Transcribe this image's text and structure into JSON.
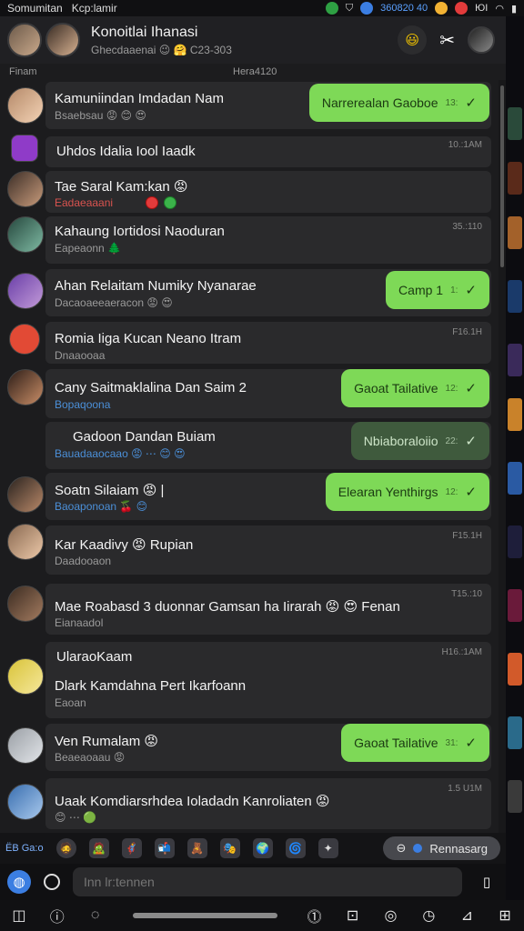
{
  "status_bar": {
    "left_1": "Somumitan",
    "left_2": "Kcp:lamir",
    "right_label": "360820 40",
    "right_2": "ЮΙ",
    "colors": [
      "#2ea043",
      "#3b7ee2",
      "#f2b233",
      "#e23b3b"
    ]
  },
  "header": {
    "title": "Konoitlai Ihanasi",
    "subtitle": "Ghecdaaenai 😉 🤗 C23-303",
    "actions": {
      "smile": "😃",
      "tools": "✂",
      "avatar": ""
    }
  },
  "subbar": {
    "left": "Finam",
    "center": "Hera4120"
  },
  "chats": [
    {
      "title": "Kamuniindan Imdadan Nam",
      "sub": "Bsaebsau 😡 😊 😍",
      "sub_color": "gray",
      "bubble": {
        "text": "Narrerealan Gaoboe",
        "time": "13:",
        "style": "bright"
      }
    },
    {
      "title": "Uhdos Idalia Iool Iaadk",
      "sub": "",
      "time": "10.:1AM",
      "sub_color": "gray"
    },
    {
      "title": "Tae Saral Kam:kan 😡",
      "sub": "Eadaeaaani",
      "sub_color": "red"
    },
    {
      "title": "Kahaung Iortidosi Naoduran",
      "sub": "Eapeaonn 🌲",
      "time": "35.:110",
      "sub_color": "gray"
    },
    {
      "title": "Ahan Relaitam Numiky Nyanarae",
      "sub": "Dacaoaeeaeracon 😡 😍",
      "sub_color": "gray",
      "bubble": {
        "text": "Camp 1",
        "time": "1:",
        "style": "bright"
      }
    },
    {
      "title": "Romia Iiga Kucan Neano Itram",
      "sub": "Dnaaooaa",
      "time": "F16.1H",
      "sub_color": "gray"
    },
    {
      "title": "Cany Saitmaklalina Dan Saim 2",
      "sub": "Bopaqoona",
      "sub_color": "blue",
      "bubble": {
        "text": "Gaoat Tailative",
        "time": "12:",
        "style": "bright"
      }
    },
    {
      "title": "Gadoon Dandan Buiam",
      "sub": "Bauadaaocaao 😡 ⋯ 😊 😍",
      "sub_color": "blue",
      "bubble": {
        "text": "Nbiaboraloiio",
        "time": "22:",
        "style": "dim"
      }
    },
    {
      "title": "Soatn Silaiam 😡 |",
      "sub": "Baoaponoan 🍒 😊",
      "sub_color": "blue",
      "bubble": {
        "text": "Elearan Yenthirgs",
        "time": "12:",
        "style": "bright"
      }
    },
    {
      "title": "Kar Kaadivy 😡 Rupian",
      "sub": "Daadooaon",
      "time": "F15.1H",
      "sub_color": "gray"
    },
    {
      "title": "Mae Roabasd 3 duonnar Gamsan ha Iirarah 😡 😍 Fenan",
      "sub": "Eianaadol",
      "time": "T15.:10",
      "sub_color": "gray"
    },
    {
      "title": "UlaraoKaam",
      "title2": "Dlark Kamdahna Pert Ikarfoann",
      "sub": "Eaoan",
      "time": "H16.:1AM",
      "sub_color": "gray"
    },
    {
      "title": "Ven Rumalam 😡",
      "sub": "Beaeaoaau 😡",
      "sub_color": "gray",
      "bubble": {
        "text": "Gaoat Tailative",
        "time": "31:",
        "style": "bright"
      }
    },
    {
      "title": "Uaak Komdiarsrhdea Ioladadn Kanroliaten 😡",
      "sub": "😊 ⋯ 🟢",
      "time": "1.5 U1M",
      "sub_color": "gray"
    }
  ],
  "bottom_tabs": {
    "label": "ЁВ Ga:o",
    "pill_text": "Rennasarg",
    "icons": [
      "🧔",
      "🧟",
      "🦸",
      "📬",
      "🧸",
      "🎭",
      "🌍",
      "🌀",
      "✦"
    ]
  },
  "composer": {
    "placeholder": "Inn lr:tennen"
  },
  "navbar": {
    "icons": [
      "◫",
      "ⓘ",
      "◌",
      "⓵",
      "⊡",
      "◎",
      "◷",
      "⊿",
      "⊞"
    ]
  }
}
